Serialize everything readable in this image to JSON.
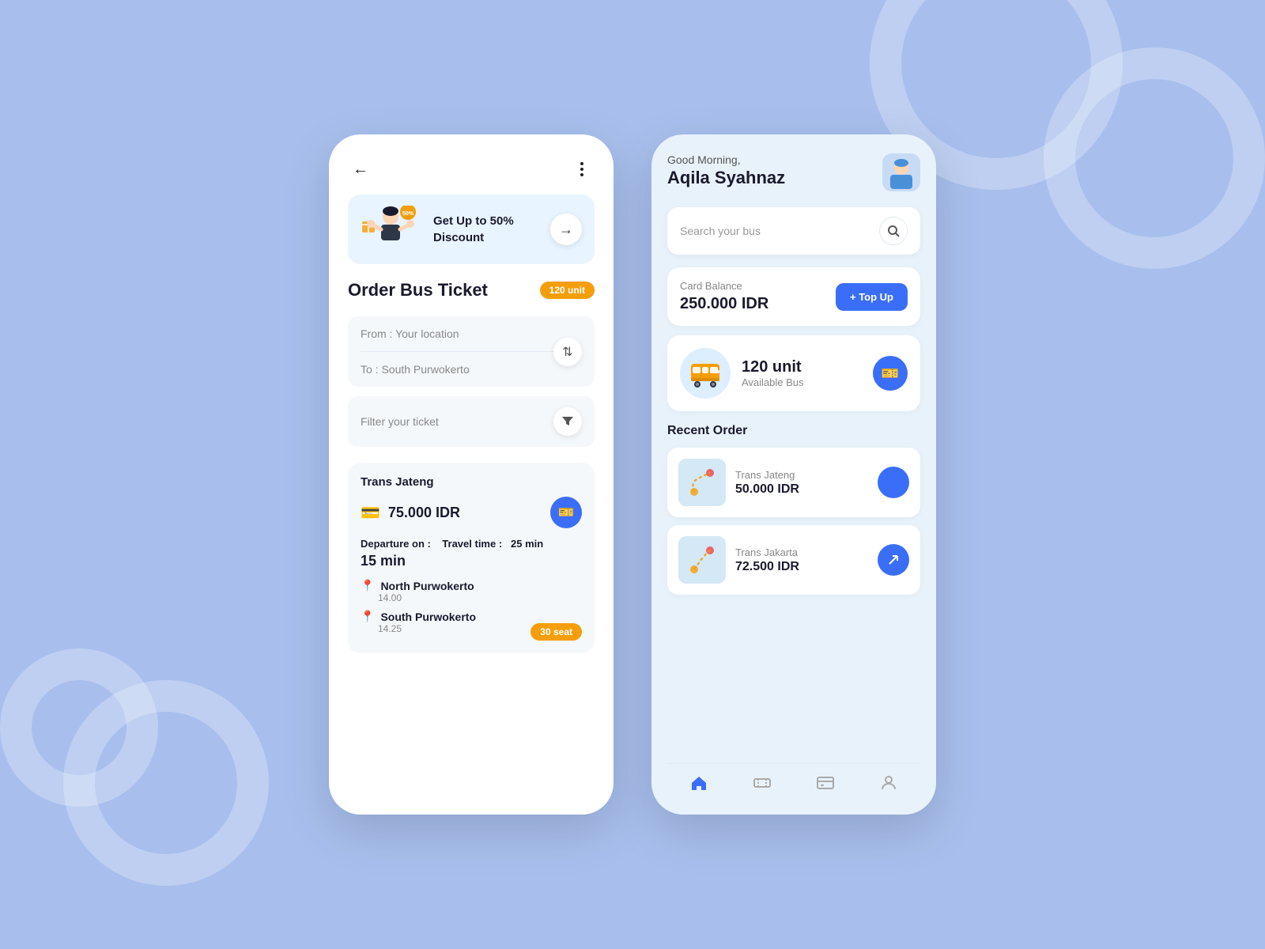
{
  "background_color": "#a8bfed",
  "left_phone": {
    "back_label": "←",
    "more_label": "⋮",
    "promo": {
      "text": "Get Up to\n50% Discount",
      "arrow": "→"
    },
    "order_title": "Order Bus Ticket",
    "unit_badge": "120 unit",
    "from_placeholder": "From : Your location",
    "to_placeholder": "To : South Purwokerto",
    "filter_placeholder": "Filter your ticket",
    "ticket": {
      "operator": "Trans Jateng",
      "price": "75.000 IDR",
      "departure_label": "Departure on :",
      "travel_time_label": "Travel time :",
      "travel_time_value": "25 min",
      "departure_countdown": "15 min",
      "stops": [
        {
          "name": "North Purwokerto",
          "time": "14.00",
          "color": "blue"
        },
        {
          "name": "South Purwokerto",
          "time": "14.25",
          "color": "red"
        }
      ],
      "seat_badge": "30 seat"
    }
  },
  "right_phone": {
    "greeting": "Good Morning,",
    "user_name": "Aqila Syahnaz",
    "search_placeholder": "Search your bus",
    "card_balance": {
      "label": "Card Balance",
      "amount": "250.000 IDR",
      "topup_label": "+ Top Up"
    },
    "available_bus": {
      "count": "120 unit",
      "label": "Available Bus"
    },
    "recent_orders_title": "Recent Order",
    "orders": [
      {
        "operator": "Trans Jateng",
        "price": "50.000 IDR"
      },
      {
        "operator": "Trans Jakarta",
        "price": "72.500 IDR"
      }
    ],
    "nav_items": [
      "home",
      "ticket",
      "card",
      "profile"
    ]
  }
}
